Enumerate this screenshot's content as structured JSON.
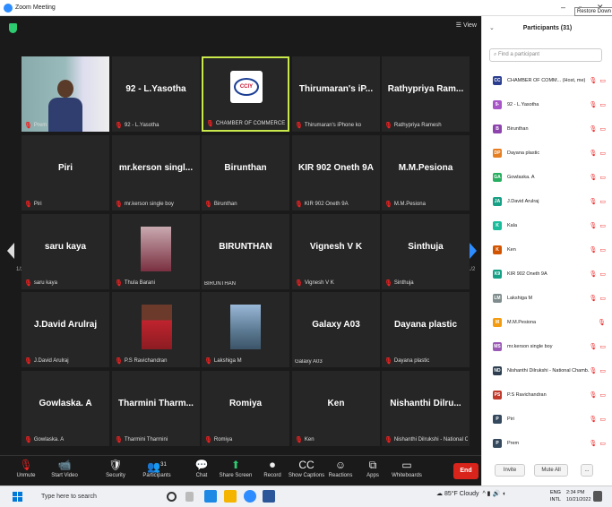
{
  "window": {
    "title": "Zoom Meeting",
    "minimize": "–",
    "restore": "▫",
    "close": "✕",
    "restore_tooltip": "Restore Down"
  },
  "meeting": {
    "view_label": "☰ View",
    "page_left": "1/2",
    "page_right": "1/2",
    "tiles": [
      {
        "name": "",
        "label": "Prem",
        "type": "video"
      },
      {
        "name": "92 - L.Yasotha",
        "label": "92 - L.Yasotha"
      },
      {
        "name": "",
        "label": "CHAMBER OF COMMERCE AND I...",
        "type": "logo",
        "logo_text": "CCIY"
      },
      {
        "name": "Thirumaran's iP...",
        "label": "Thirumaran's iPhone ko"
      },
      {
        "name": "Rathypriya Ram...",
        "label": "Rathypriya Ramesh"
      },
      {
        "name": "Piri",
        "label": "Piri"
      },
      {
        "name": "mr.kerson singl...",
        "label": "mr.kerson single boy"
      },
      {
        "name": "Birunthan",
        "label": "Birunthan"
      },
      {
        "name": "KIR 902 Oneth 9A",
        "label": "KIR 902 Oneth 9A"
      },
      {
        "name": "M.M.Pesiona",
        "label": "M.M.Pesiona"
      },
      {
        "name": "saru kaya",
        "label": "saru kaya"
      },
      {
        "name": "",
        "label": "Thula Barani",
        "type": "photo"
      },
      {
        "name": "BIRUNTHAN",
        "label": "BIRUNTHAN",
        "nomic": true
      },
      {
        "name": "Vignesh V K",
        "label": "Vignesh V K"
      },
      {
        "name": "Sinthuja",
        "label": "Sinthuja"
      },
      {
        "name": "J.David Arulraj",
        "label": "J.David Arulraj"
      },
      {
        "name": "",
        "label": "P.S Ravichandran",
        "type": "photo2"
      },
      {
        "name": "",
        "label": "Lakshiga M",
        "type": "photo3"
      },
      {
        "name": "Galaxy A03",
        "label": "Galaxy A03",
        "nomic": true
      },
      {
        "name": "Dayana plastic",
        "label": "Dayana plastic"
      },
      {
        "name": "Gowlaska. A",
        "label": "Gowlaska. A"
      },
      {
        "name": "Tharmini Tharm...",
        "label": "Tharmini Tharmini"
      },
      {
        "name": "Romiya",
        "label": "Romiya"
      },
      {
        "name": "Ken",
        "label": "Ken"
      },
      {
        "name": "Nishanthi Dilru...",
        "label": "Nishanthi Dilrukshi - National Cha..."
      }
    ]
  },
  "toolbar": {
    "items": [
      {
        "label": "Unmute",
        "icon": "🎙"
      },
      {
        "label": "Start Video",
        "icon": "📹"
      },
      {
        "label": "Security",
        "icon": "🛡"
      },
      {
        "label": "Participants",
        "icon": "👥",
        "count": "31"
      },
      {
        "label": "Chat",
        "icon": "💬"
      },
      {
        "label": "Share Screen",
        "icon": "⬆"
      },
      {
        "label": "Record",
        "icon": "⏺"
      },
      {
        "label": "Show Captions",
        "icon": "CC"
      },
      {
        "label": "Reactions",
        "icon": "☺"
      },
      {
        "label": "Apps",
        "icon": "⧉"
      },
      {
        "label": "Whiteboards",
        "icon": "▭"
      }
    ],
    "end_label": "End"
  },
  "panel": {
    "title": "Participants (31)",
    "collapse": "⌄",
    "search_placeholder": "Find a participant",
    "participants": [
      {
        "initials": "CC",
        "name": "CHAMBER OF COMM... (Host, me)",
        "color": "#2a3d8f"
      },
      {
        "initials": "9-",
        "name": "92 - L.Yasotha",
        "color": "#a855c8"
      },
      {
        "initials": "B",
        "name": "Birunthan",
        "color": "#8e44ad"
      },
      {
        "initials": "DP",
        "name": "Dayana plastic",
        "color": "#e67e22"
      },
      {
        "initials": "GA",
        "name": "Gowlaska. A",
        "color": "#27ae60"
      },
      {
        "initials": "JA",
        "name": "J.David Arulraj",
        "color": "#16a085"
      },
      {
        "initials": "K",
        "name": "Kala",
        "color": "#1abc9c"
      },
      {
        "initials": "K",
        "name": "Ken",
        "color": "#d35400"
      },
      {
        "initials": "K9",
        "name": "KIR 902 Oneth 9A",
        "color": "#16a085"
      },
      {
        "initials": "LM",
        "name": "Lakshiga M",
        "color": "#7f8c8d"
      },
      {
        "initials": "M",
        "name": "M.M.Pesiona",
        "color": "#f39c12"
      },
      {
        "initials": "MS",
        "name": "mr.kerson single boy",
        "color": "#9b59b6"
      },
      {
        "initials": "ND",
        "name": "Nishanthi Dilrukshi - National Chamb...",
        "color": "#2c3e50"
      },
      {
        "initials": "PS",
        "name": "P.S Ravichandran",
        "color": "#c0392b"
      },
      {
        "initials": "P",
        "name": "Piri",
        "color": "#34495e"
      },
      {
        "initials": "P",
        "name": "Prem",
        "color": "#34495e"
      }
    ],
    "invite_label": "Invite",
    "mute_all_label": "Mute All",
    "more_label": "..."
  },
  "taskbar": {
    "search_text": "Type here to search",
    "weather": "85°F Cloudy",
    "lang": "ENG",
    "lang2": "INTL",
    "time": "2:34 PM",
    "date": "10/21/2022"
  }
}
